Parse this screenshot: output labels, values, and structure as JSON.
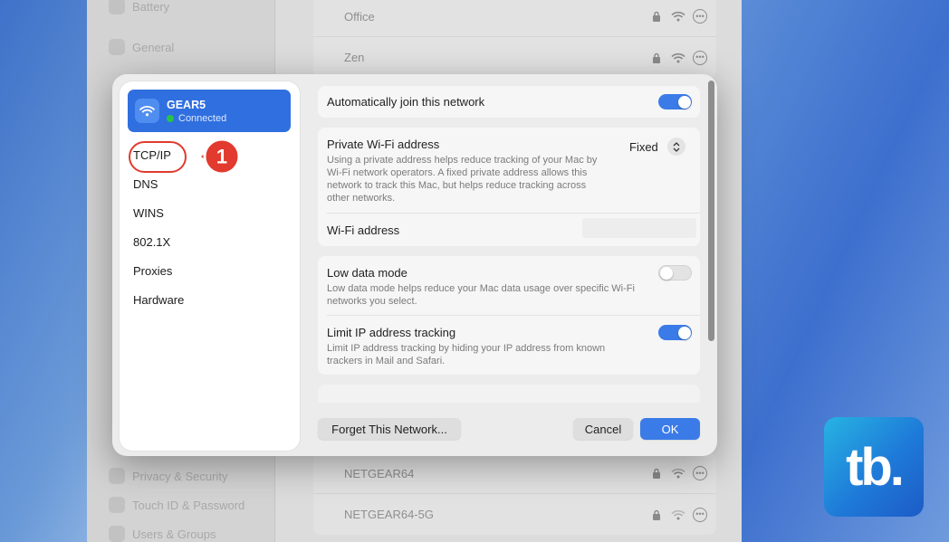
{
  "background_window": {
    "sidebar_items": [
      {
        "label": "Battery"
      },
      {
        "label": "General"
      },
      {
        "label": "Privacy & Security"
      },
      {
        "label": "Touch ID & Password"
      },
      {
        "label": "Users & Groups"
      }
    ],
    "networks_top": [
      "Office",
      "Zen"
    ],
    "networks_bottom": [
      "NETGEAR64",
      "NETGEAR64-5G"
    ]
  },
  "dialog": {
    "sidebar": {
      "network_name": "GEAR5",
      "network_status": "Connected",
      "items": [
        "TCP/IP",
        "DNS",
        "WINS",
        "802.1X",
        "Proxies",
        "Hardware"
      ]
    },
    "callout_number": "1",
    "auto_join": {
      "label": "Automatically join this network",
      "enabled": true
    },
    "private_address": {
      "label": "Private Wi-Fi address",
      "value": "Fixed",
      "description": "Using a private address helps reduce tracking of your Mac by Wi-Fi network operators. A fixed private address allows this network to track this Mac, but helps reduce tracking across other networks."
    },
    "wifi_address": {
      "label": "Wi-Fi address"
    },
    "low_data": {
      "label": "Low data mode",
      "description": "Low data mode helps reduce your Mac data usage over specific Wi-Fi networks you select.",
      "enabled": false
    },
    "limit_ip": {
      "label": "Limit IP address tracking",
      "description": "Limit IP address tracking by hiding your IP address from known trackers in Mail and Safari.",
      "enabled": true
    },
    "buttons": {
      "forget": "Forget This Network...",
      "cancel": "Cancel",
      "ok": "OK"
    }
  },
  "colors": {
    "accent": "#3a7be8",
    "selected": "#2f6fe0",
    "callout": "#e23a2e",
    "connected": "#27c446"
  },
  "logo": {
    "text": "tb."
  }
}
